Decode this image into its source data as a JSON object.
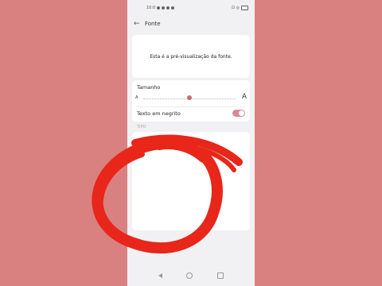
{
  "statusbar": {
    "time": "10:0",
    "right_text": "⊡ ◎"
  },
  "appbar": {
    "back_icon": "arrow-left-icon",
    "title": "Fonte"
  },
  "preview": {
    "text": "Esta é a pré-visualização da fonte."
  },
  "size": {
    "label": "Tamanho",
    "small_glyph": "A",
    "large_glyph": "A",
    "level": 0.5
  },
  "bold": {
    "label": "Texto em negrito",
    "enabled": true
  },
  "type_section": {
    "label": "TIPO"
  },
  "colors": {
    "background": "#d98080",
    "accent": "#c96a7a",
    "annotation": "#e8261a"
  }
}
